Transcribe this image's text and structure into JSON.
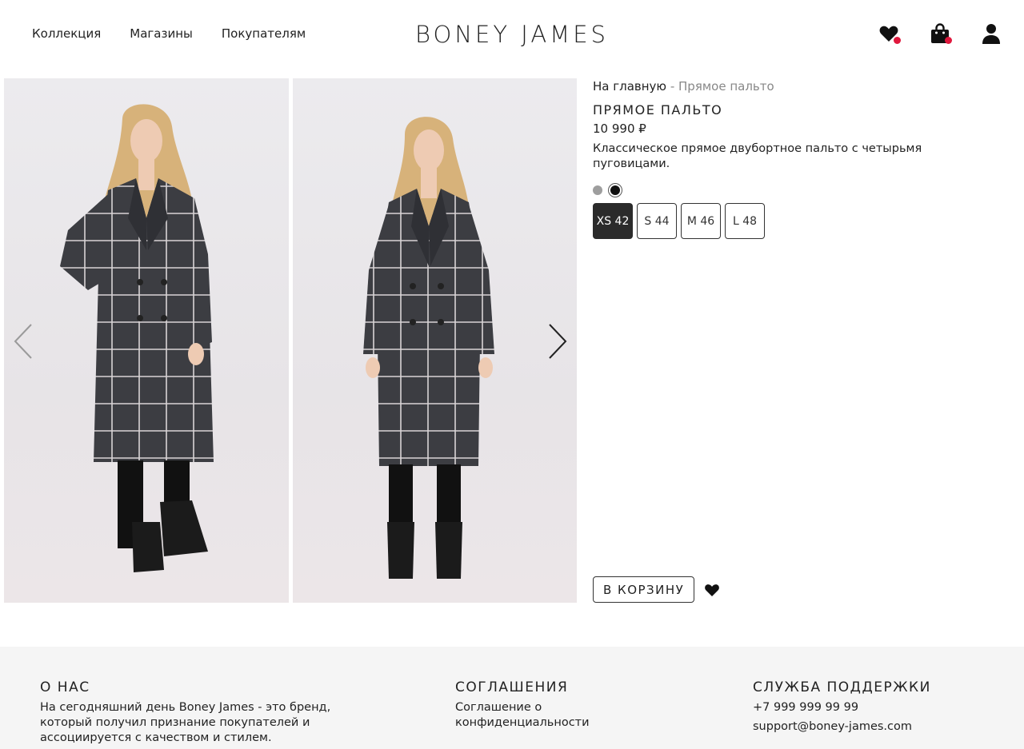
{
  "header": {
    "nav": [
      "Коллекция",
      "Магазины",
      "Покупателям"
    ],
    "logo": "BONEY JAMES",
    "icons": [
      "heart-icon",
      "shopping-bag-icon",
      "user-icon"
    ],
    "badge_color": "#e0183d"
  },
  "gallery": {
    "prev_icon": "chevron-left-icon",
    "next_icon": "chevron-right-icon"
  },
  "product": {
    "breadcrumb_home": "На главную",
    "breadcrumb_sep": " - ",
    "breadcrumb_current": "Прямое пальто",
    "title": "ПРЯМОЕ ПАЛЬТО",
    "price": "10 990 ₽",
    "description": "Классическое прямое двубортное пальто с четырьмя пуговицами.",
    "colors": [
      "#9e9e9e",
      "#111111"
    ],
    "selected_color": 1,
    "sizes": [
      "XS 42",
      "S 44",
      "M 46",
      "L 48"
    ],
    "selected_size": 0,
    "cart_label": "В КОРЗИНУ"
  },
  "footer": {
    "about_title": "О НАС",
    "about_text": "На сегодняшний день Boney James - это бренд, который получил признание покупателей и ассоциируется с качеством и стилем.",
    "agreements_title": "СОГЛАШЕНИЯ",
    "agreements_link": "Соглашение о конфиденциальности",
    "support_title": "СЛУЖБА ПОДДЕРЖКИ",
    "support_phone": "+7 999 999 99 99",
    "support_email": "support@boney-james.com"
  }
}
